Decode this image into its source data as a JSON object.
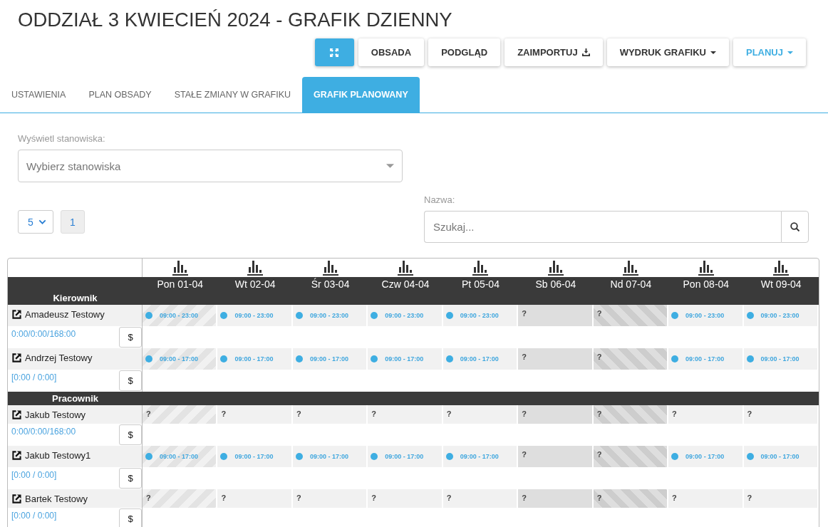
{
  "page": {
    "title": "ODDZIAŁ 3 KWIECIEŃ 2024 - GRAFIK DZIENNY"
  },
  "toolbar": [
    {
      "kind": "expand",
      "active": true
    },
    {
      "kind": "plain",
      "label": "OBSADA",
      "active": false
    },
    {
      "kind": "plain",
      "label": "PODGLĄD",
      "active": false
    },
    {
      "kind": "import",
      "label": "ZAIMPORTUJ",
      "active": false
    },
    {
      "kind": "dropdown",
      "label": "WYDRUK GRAFIKU",
      "active": false
    },
    {
      "kind": "dropdown",
      "label": "PLANUJ",
      "active": true
    }
  ],
  "tabs": [
    {
      "label": "USTAWIENIA",
      "selected": false
    },
    {
      "label": "PLAN OBSADY",
      "selected": false
    },
    {
      "label": "STAŁE ZMIANY W GRAFIKU",
      "selected": false
    },
    {
      "label": "GRAFIK PLANOWANY",
      "selected": true
    }
  ],
  "filters": {
    "positions": {
      "label": "Wyświetl stanowiska:",
      "placeholder": "Wybierz stanowiska"
    },
    "page_size": {
      "value": "5"
    },
    "pagination": [
      {
        "label": "1",
        "selected": true
      }
    ],
    "search": {
      "label": "Nazwa:",
      "placeholder": "Szukaj..."
    }
  },
  "schedule": {
    "days": [
      {
        "label": "Pon 01-04",
        "kind": "holiday"
      },
      {
        "label": "Wt 02-04",
        "kind": "workday"
      },
      {
        "label": "Śr 03-04",
        "kind": "workday"
      },
      {
        "label": "Czw 04-04",
        "kind": "workday"
      },
      {
        "label": "Pt 05-04",
        "kind": "workday"
      },
      {
        "label": "Sb 06-04",
        "kind": "saturday"
      },
      {
        "label": "Nd 07-04",
        "kind": "sunday"
      },
      {
        "label": "Pon 08-04",
        "kind": "workday"
      },
      {
        "label": "Wt 09-04",
        "kind": "workday"
      }
    ],
    "groups": [
      {
        "name": "Kierownik",
        "employees": [
          {
            "name": "Amadeusz Testowy",
            "hours": "0:00/0:00/168:00",
            "button": "$",
            "shifts": [
              {
                "kind": "shift",
                "text": "09:00 - 23:00"
              },
              {
                "kind": "shift",
                "text": "09:00 - 23:00"
              },
              {
                "kind": "shift",
                "text": "09:00 - 23:00"
              },
              {
                "kind": "shift",
                "text": "09:00 - 23:00"
              },
              {
                "kind": "shift",
                "text": "09:00 - 23:00"
              },
              {
                "kind": "open",
                "text": "?"
              },
              {
                "kind": "open",
                "text": "?"
              },
              {
                "kind": "shift",
                "text": "09:00 - 23:00"
              },
              {
                "kind": "shift",
                "text": "09:00 - 23:00"
              }
            ]
          },
          {
            "name": "Andrzej Testowy",
            "hours": "[0:00 / 0:00]",
            "button": "$",
            "shifts": [
              {
                "kind": "shift",
                "text": "09:00 - 17:00"
              },
              {
                "kind": "shift",
                "text": "09:00 - 17:00"
              },
              {
                "kind": "shift",
                "text": "09:00 - 17:00"
              },
              {
                "kind": "shift",
                "text": "09:00 - 17:00"
              },
              {
                "kind": "shift",
                "text": "09:00 - 17:00"
              },
              {
                "kind": "open",
                "text": "?"
              },
              {
                "kind": "open",
                "text": "?"
              },
              {
                "kind": "shift",
                "text": "09:00 - 17:00"
              },
              {
                "kind": "shift",
                "text": "09:00 - 17:00"
              }
            ]
          }
        ]
      },
      {
        "name": "Pracownik",
        "employees": [
          {
            "name": "Jakub Testowy",
            "hours": "0:00/0:00/168:00",
            "button": "$",
            "shifts": [
              {
                "kind": "open",
                "text": "?"
              },
              {
                "kind": "open",
                "text": "?"
              },
              {
                "kind": "open",
                "text": "?"
              },
              {
                "kind": "open",
                "text": "?"
              },
              {
                "kind": "open",
                "text": "?"
              },
              {
                "kind": "open",
                "text": "?"
              },
              {
                "kind": "open",
                "text": "?"
              },
              {
                "kind": "open",
                "text": "?"
              },
              {
                "kind": "open",
                "text": "?"
              }
            ]
          },
          {
            "name": "Jakub Testowy1",
            "hours": "[0:00 / 0:00]",
            "button": "$",
            "shifts": [
              {
                "kind": "shift",
                "text": "09:00 - 17:00"
              },
              {
                "kind": "shift",
                "text": "09:00 - 17:00"
              },
              {
                "kind": "shift",
                "text": "09:00 - 17:00"
              },
              {
                "kind": "shift",
                "text": "09:00 - 17:00"
              },
              {
                "kind": "shift",
                "text": "09:00 - 17:00"
              },
              {
                "kind": "open",
                "text": "?"
              },
              {
                "kind": "open",
                "text": "?"
              },
              {
                "kind": "shift",
                "text": "09:00 - 17:00"
              },
              {
                "kind": "shift",
                "text": "09:00 - 17:00"
              }
            ]
          },
          {
            "name": "Bartek Testowy",
            "hours": "[0:00 / 0:00]",
            "button": "$",
            "shifts": [
              {
                "kind": "open",
                "text": "?"
              },
              {
                "kind": "open",
                "text": "?"
              },
              {
                "kind": "open",
                "text": "?"
              },
              {
                "kind": "open",
                "text": "?"
              },
              {
                "kind": "open",
                "text": "?"
              },
              {
                "kind": "open",
                "text": "?"
              },
              {
                "kind": "open",
                "text": "?"
              },
              {
                "kind": "open",
                "text": "?"
              },
              {
                "kind": "open",
                "text": "?"
              }
            ]
          }
        ]
      }
    ]
  }
}
